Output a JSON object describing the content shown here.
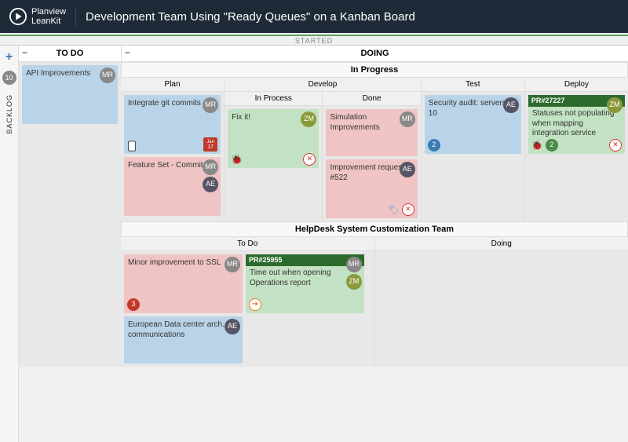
{
  "header": {
    "brand1": "Planview",
    "brand2": "LeanKit",
    "title": "Development Team Using \"Ready Queues\" on a Kanban Board"
  },
  "strip": "STARTED",
  "backlog": {
    "count": "10",
    "label": "BACKLOG"
  },
  "cols": {
    "todo": "TO DO",
    "doing": "DOING"
  },
  "lane1": {
    "title": "In Progress",
    "plan": "Plan",
    "develop": "Develop",
    "test": "Test",
    "deploy": "Deploy",
    "inprocess": "In Process",
    "done": "Done"
  },
  "lane2": {
    "title": "HelpDesk System Customization Team",
    "todo": "To Do",
    "doing": "Doing"
  },
  "cards": {
    "api": {
      "title": "API Improvements",
      "av": "MR"
    },
    "git": {
      "title": "Integrate git commits",
      "av": "MR",
      "cal_m": "Jan",
      "cal_d": "17"
    },
    "fset": {
      "title": "Feature Set - Commits",
      "av": "MR",
      "av2": "AE"
    },
    "fix": {
      "title": "Fix it!",
      "av": "ZM"
    },
    "sim": {
      "title": "Simulation Improvements",
      "av": "MR"
    },
    "imp": {
      "title": "Improvement request #522",
      "av": "AE"
    },
    "sec": {
      "title": "Security audit: servers 1-10",
      "av": "AE",
      "badge": "2"
    },
    "pr2": {
      "hdr": "PR#27227",
      "title": "Statuses not populating when mapping integration service",
      "av": "ZM",
      "badge": "2"
    },
    "ssl": {
      "title": "Minor improvement to SSL",
      "av": "MR",
      "badge": "3"
    },
    "pr1": {
      "hdr": "PR#25955",
      "title": "Time out when opening Operations report",
      "av": "MR",
      "av2": "ZM"
    },
    "eu": {
      "title": "European Data center arch. communications",
      "av": "AE"
    }
  }
}
